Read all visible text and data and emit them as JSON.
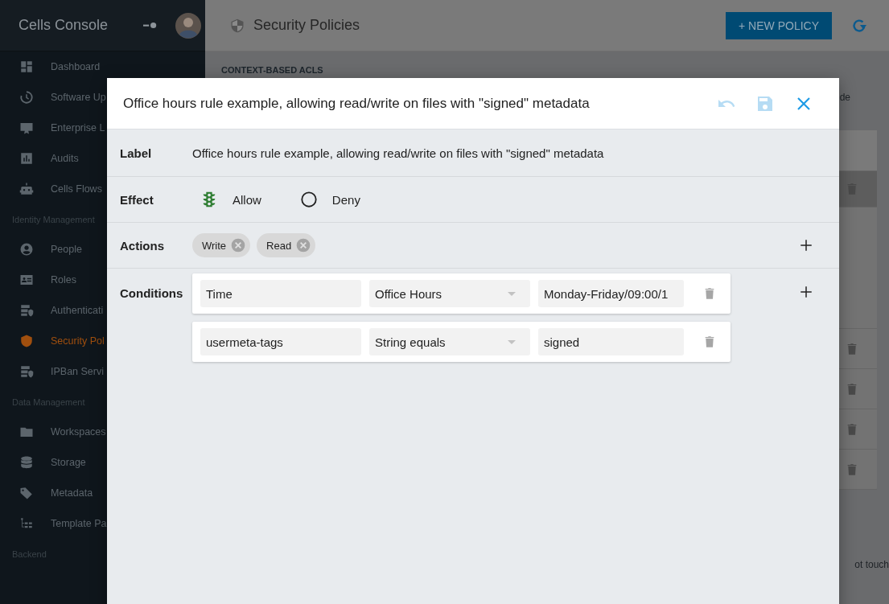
{
  "sidebar": {
    "title": "Cells Console",
    "sections": [
      {
        "items": [
          {
            "label": "Dashboard",
            "selected": false
          },
          {
            "label": "Software Up",
            "selected": false
          },
          {
            "label": "Enterprise L",
            "selected": false
          },
          {
            "label": "Audits",
            "selected": false
          },
          {
            "label": "Cells Flows",
            "selected": false
          }
        ]
      },
      {
        "heading": "Identity Management",
        "items": [
          {
            "label": "People",
            "selected": false
          },
          {
            "label": "Roles",
            "selected": false
          },
          {
            "label": "Authenticati",
            "selected": false
          },
          {
            "label": "Security Pol",
            "selected": true
          },
          {
            "label": "IPBan Servi",
            "selected": false
          }
        ]
      },
      {
        "heading": "Data Management",
        "items": [
          {
            "label": "Workspaces",
            "selected": false
          },
          {
            "label": "Storage",
            "selected": false
          },
          {
            "label": "Metadata",
            "selected": false
          },
          {
            "label": "Template Pa",
            "selected": false
          }
        ]
      },
      {
        "heading": "Backend"
      }
    ]
  },
  "page": {
    "title": "Security Policies",
    "new_button": "+ NEW POLICY",
    "section_heading": "CONTEXT-BASED ACLS",
    "fragment_top": "de",
    "fragment_bottom": "ot touch"
  },
  "dialog": {
    "title": "Office hours rule example, allowing read/write on files with \"signed\" metadata",
    "label": {
      "name": "Label",
      "value": "Office hours rule example, allowing read/write on files with \"signed\" metadata"
    },
    "effect": {
      "name": "Effect",
      "options": [
        {
          "label": "Allow",
          "selected": true
        },
        {
          "label": "Deny",
          "selected": false
        }
      ]
    },
    "actions": {
      "name": "Actions",
      "chips": [
        "Write",
        "Read"
      ]
    },
    "conditions": {
      "name": "Conditions",
      "rows": [
        {
          "field": "Time",
          "operator": "Office Hours",
          "value": "Monday-Friday/09:00/1"
        },
        {
          "field": "usermeta-tags",
          "operator": "String equals",
          "value": "signed"
        }
      ]
    }
  }
}
